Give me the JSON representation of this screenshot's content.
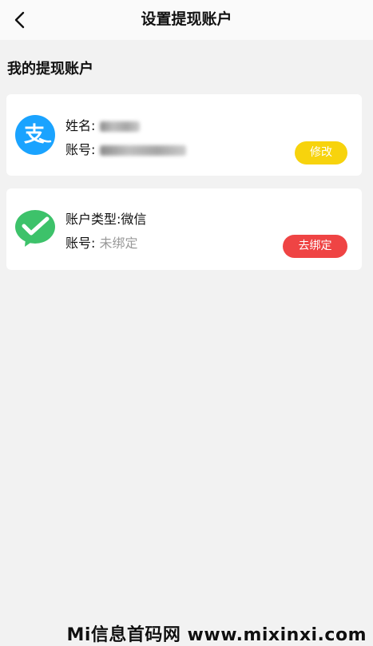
{
  "header": {
    "title": "设置提现账户",
    "back_icon": "chevron-left-icon"
  },
  "section": {
    "title": "我的提现账户"
  },
  "accounts": [
    {
      "type": "alipay",
      "logo_icon": "alipay-icon",
      "logo_color": "#1aa3ff",
      "name_label": "姓名:",
      "account_label": "账号:",
      "action_label": "修改",
      "action_color": "#f7d30d"
    },
    {
      "type": "wechat",
      "logo_icon": "wechat-pay-icon",
      "logo_color": "#3dc26a",
      "type_label": "账户类型:微信",
      "account_label": "账号:",
      "account_value": "未绑定",
      "action_label": "去绑定",
      "action_color": "#ef4444"
    }
  ],
  "watermark": "Mi信息首码网 www.mixinxi.com"
}
